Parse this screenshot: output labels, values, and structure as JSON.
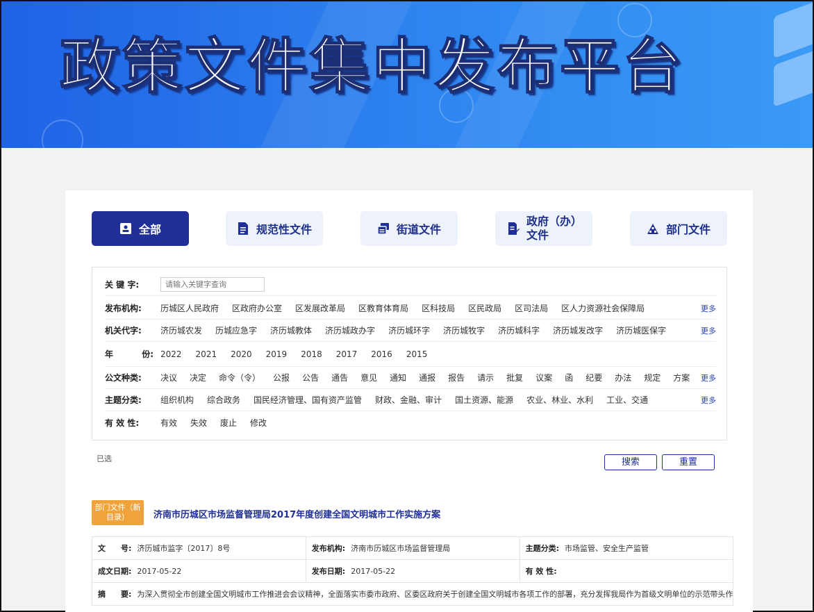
{
  "banner": {
    "title": "政策文件集中发布平台"
  },
  "tabs": [
    {
      "label": "全部",
      "icon": "id-card-icon",
      "active": true
    },
    {
      "label": "规范性文件",
      "icon": "document-icon",
      "active": false
    },
    {
      "label": "街道文件",
      "icon": "stack-files-icon",
      "active": false
    },
    {
      "label": "政府（办）文件",
      "icon": "edit-document-icon",
      "active": false
    },
    {
      "label": "部门文件",
      "icon": "org-chart-icon",
      "active": false
    }
  ],
  "filters": {
    "keyword": {
      "label": "关 键 字:",
      "placeholder": "请输入关键字查询"
    },
    "agency": {
      "label": "发布机构:",
      "items": [
        "历城区人民政府",
        "区政府办公室",
        "区发展改革局",
        "区教育体育局",
        "区科技局",
        "区民政局",
        "区司法局",
        "区人力资源社会保障局"
      ],
      "more": "更多"
    },
    "code": {
      "label": "机关代字:",
      "items": [
        "济历城农发",
        "历城应急字",
        "济历城教体",
        "济历城政办字",
        "济历城环字",
        "济历城牧字",
        "济历城科字",
        "济历城发改字",
        "济历城医保字"
      ],
      "more": "更多"
    },
    "year": {
      "label": "年    份:",
      "items": [
        "2022",
        "2021",
        "2020",
        "2019",
        "2018",
        "2017",
        "2016",
        "2015"
      ]
    },
    "doc_type": {
      "label": "公文种类:",
      "items": [
        "决议",
        "决定",
        "命令（令）",
        "公报",
        "公告",
        "通告",
        "意见",
        "通知",
        "通报",
        "报告",
        "请示",
        "批复",
        "议案",
        "函",
        "纪要",
        "办法",
        "规定",
        "方案"
      ],
      "more": "更多"
    },
    "topic": {
      "label": "主题分类:",
      "items": [
        "组织机构",
        "综合政务",
        "国民经济管理、国有资产监管",
        "财政、金融、审计",
        "国土资源、能源",
        "农业、林业、水利",
        "工业、交通"
      ],
      "more": "更多"
    },
    "validity": {
      "label": "有 效 性:",
      "items": [
        "有效",
        "失效",
        "废止",
        "修改"
      ]
    }
  },
  "selected_label": "已选",
  "buttons": {
    "search": "搜索",
    "reset": "重置"
  },
  "result": {
    "badge": "部门文件（新目录）",
    "title": "济南市历城区市场监督管理局2017年度创建全国文明城市工作实施方案",
    "doc_no_label": "文　　号:",
    "doc_no": "济历城市监字〔2017〕8号",
    "issuer_label": "发布机构:",
    "issuer": "济南市历城区市场监督管理局",
    "topic_label": "主题分类:",
    "topic": "市场监管、安全生产监管",
    "date_label": "成文日期:",
    "date": "2017-05-22",
    "publish_label": "发布日期:",
    "publish": "2017-05-22",
    "validity_label": "有 效 性:",
    "validity": "",
    "abstract_label": "摘　　要:",
    "abstract": "为深入贯彻全市创建全国文明城市工作推进会会议精神，全面落实市委市政府、区委区政府关于创建全国文明城市各项工作的部署，充分发挥我局作为首级文明单位的示范带头作"
  },
  "colors": {
    "primary": "#1f2f97",
    "badge": "#f0a33a",
    "banner": "#2f86f0"
  }
}
